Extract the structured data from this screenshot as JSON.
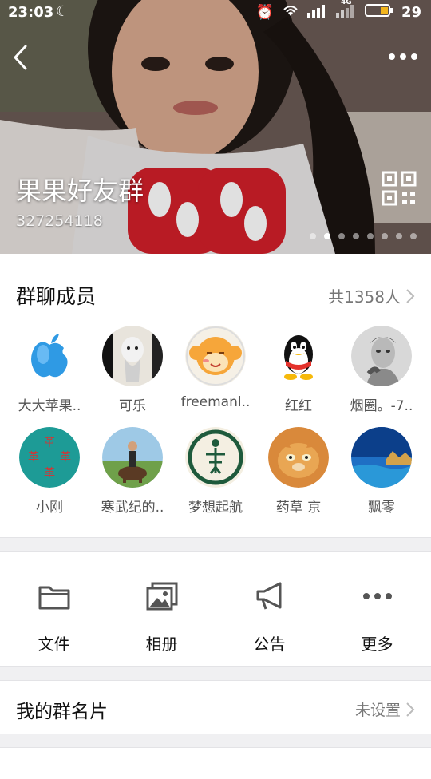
{
  "status_bar": {
    "time": "23:03",
    "battery": "29",
    "signal_label": "4G"
  },
  "group": {
    "name": "果果好友群",
    "id": "327254118"
  },
  "members_section": {
    "title": "群聊成员",
    "count": "共1358人",
    "members": [
      {
        "name": "大大苹果.."
      },
      {
        "name": "可乐"
      },
      {
        "name": "freemanl.."
      },
      {
        "name": "红红"
      },
      {
        "name": "烟圈。-7.."
      },
      {
        "name": "小刚"
      },
      {
        "name": "寒武纪的.."
      },
      {
        "name": "梦想起航"
      },
      {
        "name": "药草  京"
      },
      {
        "name": "飘零"
      }
    ]
  },
  "actions": [
    {
      "label": "文件",
      "icon": "folder-icon"
    },
    {
      "label": "相册",
      "icon": "album-icon"
    },
    {
      "label": "公告",
      "icon": "megaphone-icon"
    },
    {
      "label": "更多",
      "icon": "more-icon"
    }
  ],
  "card": {
    "label": "我的群名片",
    "value": "未设置"
  },
  "colors": {
    "accent": "#3a8ee6",
    "text_primary": "#111111",
    "text_secondary": "#777777",
    "background": "#f0f0f2"
  }
}
